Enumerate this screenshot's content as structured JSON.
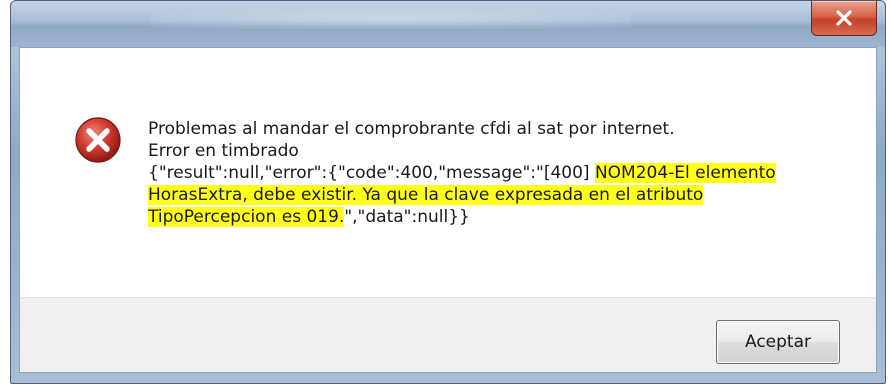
{
  "dialog": {
    "close_icon": "close-icon",
    "error_icon": "error-icon",
    "message": {
      "line1": "Problemas al mandar el comprobrante cfdi al sat por internet.",
      "line2": "Error en timbrado",
      "json_prefix": "{\"result\":null,\"error\":{\"code\":400,\"message\":\"[400] ",
      "highlight_1": "NOM204-El elemento",
      "highlight_2": "HorasExtra, debe existir. Ya que la clave expresada en el atributo",
      "highlight_3": "TipoPercepcion es 019.",
      "json_suffix": "\",\"data\":null}}"
    },
    "accept_label": "Aceptar"
  },
  "colors": {
    "highlight": "#ffff1a",
    "close_button": "#c4402a",
    "error_icon_red": "#c8342a"
  }
}
